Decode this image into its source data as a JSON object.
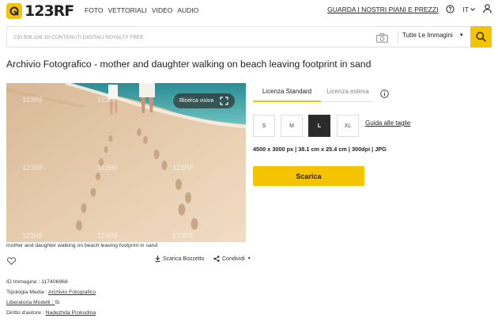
{
  "brand": {
    "logo_text": "123RF",
    "accent": "#f5c400"
  },
  "nav": [
    "FOTO",
    "VETTORIALI",
    "VIDEO",
    "AUDIO"
  ],
  "header": {
    "plans_link": "GUARDA I NOSTRI PIANI E PREZZI",
    "language": "IT"
  },
  "search": {
    "placeholder": "130.508.106  DI CONTENUTI DIGITALI ROYALTY FREE",
    "category": "Tutte Le Immagini"
  },
  "page": {
    "title": "Archivio Fotografico - mother and daughter walking on beach leaving footprint in sand"
  },
  "photo": {
    "reverse_search_label": "Ricerca visiva",
    "watermark": "123RF",
    "caption": "mother and daughter walking on beach leaving footprint in sand"
  },
  "actions": {
    "download_comp": "Scarica Bozzetto",
    "share": "Condividi"
  },
  "meta": [
    {
      "label": "ID Immagine : ",
      "value": "117406968",
      "link": false
    },
    {
      "label": "Tipologia Media : ",
      "value": "Archivio Fotografico",
      "link": true
    },
    {
      "label": "Liberatoria Modelli : ",
      "value": "Si",
      "link": true
    },
    {
      "label": "Diritto d'autore : ",
      "value": "Nadezhda Prokudina",
      "link": true
    }
  ],
  "license": {
    "tabs": [
      "Licenza Standard",
      "Licenza estesa"
    ],
    "active_tab": "Licenza Standard",
    "sizes": [
      "S",
      "M",
      "L",
      "XL"
    ],
    "selected_size": "L",
    "size_guide": "Guida alle taglie",
    "dimensions": "4500 x 3000 px | 38.1 cm x 25.4 cm | 300dpi | JPG",
    "download_label": "Scarica"
  }
}
